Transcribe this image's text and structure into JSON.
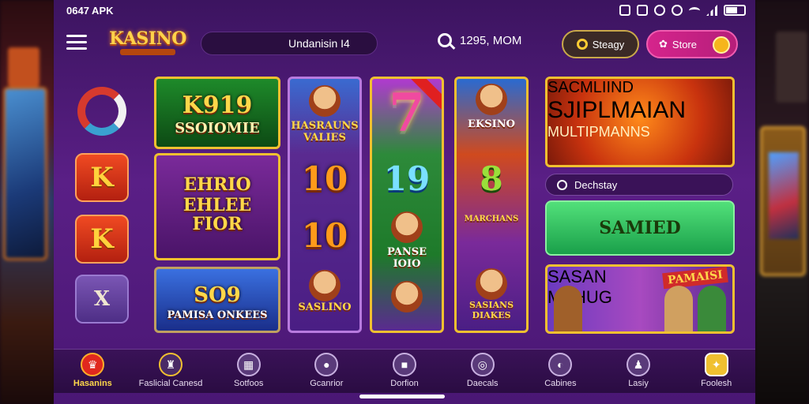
{
  "status": {
    "time": "0647 APK"
  },
  "header": {
    "logo": "KASINO",
    "search_text": "Undanisin  I4",
    "stat_text": "1295, MOM",
    "steady_label": "Steagy",
    "store_label": "Store"
  },
  "rail": [
    "",
    "K",
    "K",
    "X"
  ],
  "tiles": {
    "green": {
      "l1": "K919",
      "l2": "SSOIOMIE"
    },
    "purple": {
      "l1": "EHRIO",
      "l2": "EHLEE",
      "l3": "FIOR"
    },
    "blue": {
      "l1": "SO9",
      "l2": "PAMISA ONKEES"
    }
  },
  "columns": {
    "col1": {
      "top": "HASRAUNS VALIES",
      "n1": "10",
      "n2": "10",
      "bottom": "SASLINO"
    },
    "col2": {
      "big": "7",
      "n1": "19",
      "mid": "PANSE IOIO"
    },
    "col3": {
      "top": "EKSINO",
      "n1": "8",
      "mid": "MARCHANS",
      "bottom": "SASIANS DIAKES"
    }
  },
  "banner": {
    "l1": "SACMLIIND",
    "l2": "SJIPLMAIAN",
    "l3": "MULTIPMANNS"
  },
  "dropdown_label": "Dechstay",
  "green_button": "SAMIED",
  "promo": {
    "l1": "SASAN",
    "l2": "MAHUG",
    "flag": "PAMAISI"
  },
  "nav": [
    "Hasanins",
    "Faslicial Canesd",
    "Sotfoos",
    "Gcanrior",
    "Dorfion",
    "Daecals",
    "Cabines",
    "Lasiy",
    "Foolesh"
  ],
  "colors": {
    "accent": "#ffd84a",
    "bg_purple": "#5a1f86",
    "store_pink": "#d5248c",
    "green": "#1aa04a"
  }
}
